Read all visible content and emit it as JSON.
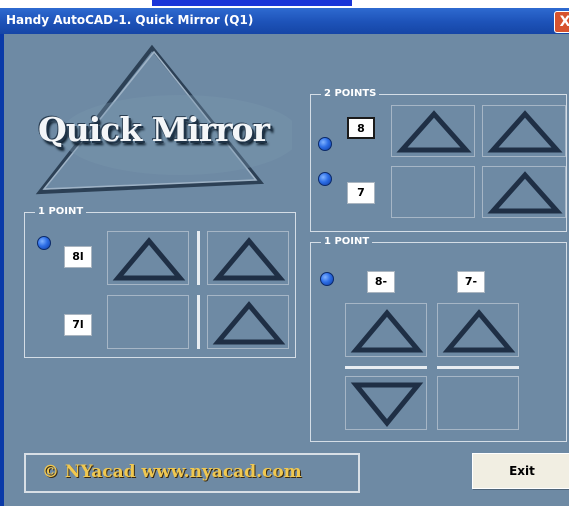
{
  "window": {
    "title": "Handy AutoCAD-1. Quick Mirror (Q1)",
    "close_label": "X"
  },
  "logo": {
    "text": "Quick Mirror"
  },
  "two_points": {
    "label": "2 POINTS",
    "input_1": "8",
    "input_2": "7"
  },
  "one_point_left": {
    "label": "1 POINT",
    "input_1": "8l",
    "input_2": "7l"
  },
  "one_point_right": {
    "label": "1 POINT",
    "input_1": "8-",
    "input_2": "7-"
  },
  "footer": {
    "text": "© NYacad  www.nyacad.com"
  },
  "exit_label": "Exit",
  "colors": {
    "background": "#6e8aa4",
    "title_bar": "#1d52b8",
    "footer_text": "#f0c850"
  }
}
